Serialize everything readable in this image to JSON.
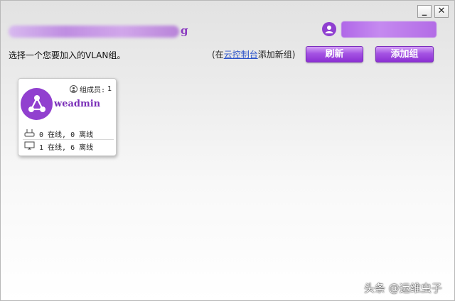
{
  "window": {
    "minimize_label": "_",
    "close_label": "✕"
  },
  "header": {
    "account_name_visible_tail": "g",
    "user_icon": "user-circle-icon"
  },
  "main": {
    "prompt": "选择一个您要加入的VLAN组。",
    "hint_prefix": "(在",
    "hint_link": "云控制台",
    "hint_suffix": "添加新组)",
    "refresh_label": "刷新",
    "add_group_label": "添加组"
  },
  "groups": [
    {
      "name": "weadmin",
      "members_label": "组成员:",
      "members_count": "1",
      "icon": "network-share-icon",
      "routers_label": "0 在线, 0 离线",
      "routers_icon": "router-icon",
      "devices_label": "1 在线, 6 离线",
      "devices_icon": "monitor-icon"
    }
  ],
  "watermark": "头条 @运维虫子",
  "colors": {
    "accent": "#9140cf",
    "button_top": "#d4a2f6",
    "button_bottom": "#8c30d3",
    "link": "#2b53c9"
  }
}
